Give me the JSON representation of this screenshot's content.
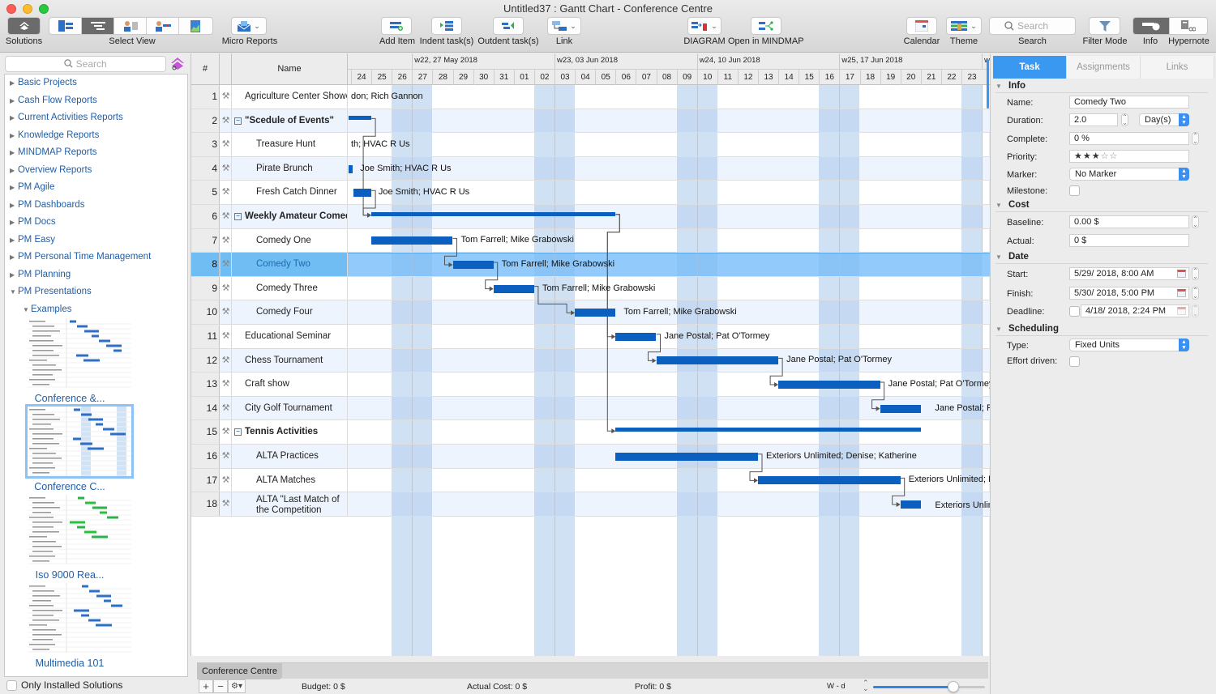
{
  "window": {
    "title": "Untitled37 : Gantt Chart - Conference Centre"
  },
  "toolbar": {
    "solutions": "Solutions",
    "select_view": "Select View",
    "micro_reports": "Micro Reports",
    "add_item": "Add Item",
    "indent": "Indent task(s)",
    "outdent": "Outdent task(s)",
    "link": "Link",
    "diagram": "DIAGRAM",
    "open_mindmap": "Open in MINDMAP",
    "calendar": "Calendar",
    "theme": "Theme",
    "search_placeholder": "Search",
    "search_label": "Search",
    "filter_mode": "Filter Mode",
    "info": "Info",
    "hypernote": "Hypernote"
  },
  "sidebar": {
    "search_placeholder": "Search",
    "items": [
      {
        "label": "Basic Projects",
        "expanded": false
      },
      {
        "label": "Cash Flow Reports",
        "expanded": false
      },
      {
        "label": "Current Activities Reports",
        "expanded": false
      },
      {
        "label": "Knowledge Reports",
        "expanded": false
      },
      {
        "label": "MINDMAP Reports",
        "expanded": false
      },
      {
        "label": "Overview Reports",
        "expanded": false
      },
      {
        "label": "PM Agile",
        "expanded": false
      },
      {
        "label": "PM Dashboards",
        "expanded": false
      },
      {
        "label": "PM Docs",
        "expanded": false
      },
      {
        "label": "PM Easy",
        "expanded": false
      },
      {
        "label": "PM Personal Time Management",
        "expanded": false
      },
      {
        "label": "PM Planning",
        "expanded": false
      },
      {
        "label": "PM Presentations",
        "expanded": true
      }
    ],
    "subfolder": "Examples",
    "thumbnails": [
      {
        "label": "Conference &...",
        "selected": false
      },
      {
        "label": "Conference C...",
        "selected": true
      },
      {
        "label": "Iso 9000 Rea...",
        "selected": false
      },
      {
        "label": "Multimedia 101",
        "selected": false
      }
    ],
    "footer_checkbox": "Only Installed Solutions"
  },
  "gantt": {
    "col_num": "#",
    "col_name": "Name",
    "weeks": [
      "w22, 27 May 2018",
      "w23, 03 Jun 2018",
      "w24, 10 Jun 2018",
      "w25, 17 Jun 2018",
      "w"
    ],
    "days": [
      "24",
      "25",
      "26",
      "27",
      "28",
      "29",
      "30",
      "31",
      "01",
      "02",
      "03",
      "04",
      "05",
      "06",
      "07",
      "08",
      "09",
      "10",
      "11",
      "12",
      "13",
      "14",
      "15",
      "16",
      "17",
      "18",
      "19",
      "20",
      "21",
      "22",
      "23"
    ],
    "weekend_day_indices": [
      2,
      3,
      9,
      10,
      16,
      17,
      23,
      24,
      30
    ],
    "rows": [
      {
        "num": "1",
        "name": "Agriculture Center  Showcase",
        "bold": false,
        "indent": 0,
        "collapsible": false,
        "bar": null,
        "resources": "don; Rich Gannon",
        "res_day": 0.0
      },
      {
        "num": "2",
        "name": "\"Scedule of Events\"",
        "bold": true,
        "indent": 0,
        "collapsible": true,
        "bar": {
          "start": -0.1,
          "end": 1.0,
          "summary": true
        },
        "resources": "",
        "res_day": null
      },
      {
        "num": "3",
        "name": "Treasure Hunt",
        "bold": false,
        "indent": 1,
        "collapsible": false,
        "bar": null,
        "resources": "th; HVAC R Us",
        "res_day": 0.0
      },
      {
        "num": "4",
        "name": "Pirate Brunch",
        "bold": false,
        "indent": 1,
        "collapsible": false,
        "bar": {
          "start": -0.1,
          "end": 0.08,
          "summary": false
        },
        "resources": "Joe Smith; HVAC R Us",
        "res_day": 0.45
      },
      {
        "num": "5",
        "name": "Fresh Catch Dinner",
        "bold": false,
        "indent": 1,
        "collapsible": false,
        "bar": {
          "start": 0.1,
          "end": 1.0,
          "summary": false
        },
        "resources": "Joe Smith; HVAC R Us",
        "res_day": 1.35
      },
      {
        "num": "6",
        "name": "Weekly Amateur Comedy",
        "bold": true,
        "indent": 0,
        "collapsible": true,
        "bar": {
          "start": 1.0,
          "end": 13.0,
          "summary": true
        },
        "resources": "",
        "res_day": null
      },
      {
        "num": "7",
        "name": "Comedy One",
        "bold": false,
        "indent": 1,
        "collapsible": false,
        "bar": {
          "start": 1.0,
          "end": 5.0,
          "summary": false
        },
        "resources": "Tom Farrell; Mike Grabowski",
        "res_day": 5.4
      },
      {
        "num": "8",
        "name": "Comedy Two",
        "bold": false,
        "indent": 1,
        "collapsible": false,
        "bar": {
          "start": 5.0,
          "end": 7.0,
          "summary": false
        },
        "resources": "Tom Farrell; Mike Grabowski",
        "res_day": 7.4,
        "selected": true
      },
      {
        "num": "9",
        "name": "Comedy Three",
        "bold": false,
        "indent": 1,
        "collapsible": false,
        "bar": {
          "start": 7.0,
          "end": 9.0,
          "summary": false
        },
        "resources": "Tom Farrell; Mike Grabowski",
        "res_day": 9.4
      },
      {
        "num": "10",
        "name": "Comedy Four",
        "bold": false,
        "indent": 1,
        "collapsible": false,
        "bar": {
          "start": 11.0,
          "end": 13.0,
          "summary": false
        },
        "resources": "Tom Farrell; Mike Grabowski",
        "res_day": 13.4
      },
      {
        "num": "11",
        "name": "Educational Seminar",
        "bold": false,
        "indent": 0,
        "collapsible": false,
        "bar": {
          "start": 13.0,
          "end": 15.0,
          "summary": false
        },
        "resources": "Jane Postal; Pat O'Tormey",
        "res_day": 15.4
      },
      {
        "num": "12",
        "name": "Chess Tournament",
        "bold": false,
        "indent": 0,
        "collapsible": false,
        "bar": {
          "start": 15.0,
          "end": 21.0,
          "summary": false
        },
        "resources": "Jane Postal; Pat O'Tormey",
        "res_day": 21.4
      },
      {
        "num": "13",
        "name": "Craft show",
        "bold": false,
        "indent": 0,
        "collapsible": false,
        "bar": {
          "start": 21.0,
          "end": 26.0,
          "summary": false
        },
        "resources": "Jane Postal; Pat O'Tormey",
        "res_day": 26.4
      },
      {
        "num": "14",
        "name": "City Golf Tournament",
        "bold": false,
        "indent": 0,
        "collapsible": false,
        "bar": {
          "start": 26.0,
          "end": 28.0,
          "summary": false
        },
        "resources": "Jane Postal; Pa",
        "res_day": 28.7
      },
      {
        "num": "15",
        "name": "Tennis Activities",
        "bold": true,
        "indent": 0,
        "collapsible": true,
        "bar": {
          "start": 13.0,
          "end": 28.0,
          "summary": true
        },
        "resources": "",
        "res_day": null
      },
      {
        "num": "16",
        "name": "ALTA Practices",
        "bold": false,
        "indent": 1,
        "collapsible": false,
        "bar": {
          "start": 13.0,
          "end": 20.0,
          "summary": false
        },
        "resources": "Exteriors Unlimited; Denise; Katherine",
        "res_day": 20.4
      },
      {
        "num": "17",
        "name": "ALTA Matches",
        "bold": false,
        "indent": 1,
        "collapsible": false,
        "bar": {
          "start": 20.0,
          "end": 27.0,
          "summary": false
        },
        "resources": "Exteriors Unlimited; D",
        "res_day": 27.4
      },
      {
        "num": "18",
        "name": "ALTA \"Last Match of the Competition",
        "bold": false,
        "indent": 1,
        "collapsible": false,
        "bar": {
          "start": 27.0,
          "end": 28.0,
          "summary": false
        },
        "resources": "Exteriors Unlimi",
        "res_day": 28.7,
        "tall": true
      }
    ],
    "links": [
      [
        1,
        5
      ],
      [
        4,
        5
      ],
      [
        6,
        7
      ],
      [
        7,
        8
      ],
      [
        8,
        9
      ],
      [
        5,
        10
      ],
      [
        10,
        11
      ],
      [
        11,
        12
      ],
      [
        12,
        13
      ],
      [
        5,
        14
      ],
      [
        15,
        16
      ],
      [
        16,
        17
      ]
    ]
  },
  "bottom": {
    "sheet_tab": "Conference Centre",
    "budget": "Budget: 0 $",
    "actual_cost": "Actual Cost: 0 $",
    "profit": "Profit: 0 $",
    "scale": "W - d",
    "zoom_level": 0.72
  },
  "inspector": {
    "tabs": [
      "Task",
      "Assignments",
      "Links"
    ],
    "active_tab": "Task",
    "info_title": "Info",
    "name_label": "Name:",
    "name_value": "Comedy Two",
    "duration_label": "Duration:",
    "duration_value": "2.0",
    "duration_unit": "Day(s)",
    "complete_label": "Complete:",
    "complete_value": "0 %",
    "priority_label": "Priority:",
    "priority_value": 3,
    "priority_max": 5,
    "marker_label": "Marker:",
    "marker_value": "No Marker",
    "milestone_label": "Milestone:",
    "milestone_checked": false,
    "cost_title": "Cost",
    "baseline_label": "Baseline:",
    "baseline_value": "0.00 $",
    "actual_label": "Actual:",
    "actual_value": "0 $",
    "date_title": "Date",
    "start_label": "Start:",
    "start_value": "5/29/ 2018,  8:00 AM",
    "finish_label": "Finish:",
    "finish_value": "5/30/ 2018,  5:00 PM",
    "deadline_label": "Deadline:",
    "deadline_value": "4/18/ 2018,  2:24 PM",
    "deadline_checked": false,
    "scheduling_title": "Scheduling",
    "type_label": "Type:",
    "type_value": "Fixed Units",
    "effort_label": "Effort driven:",
    "effort_checked": false
  },
  "colors": {
    "accent": "#3b98f1",
    "bar": "#0a5fbf",
    "selection": "#a8d3fb",
    "link_text": "#1f5ea8"
  }
}
